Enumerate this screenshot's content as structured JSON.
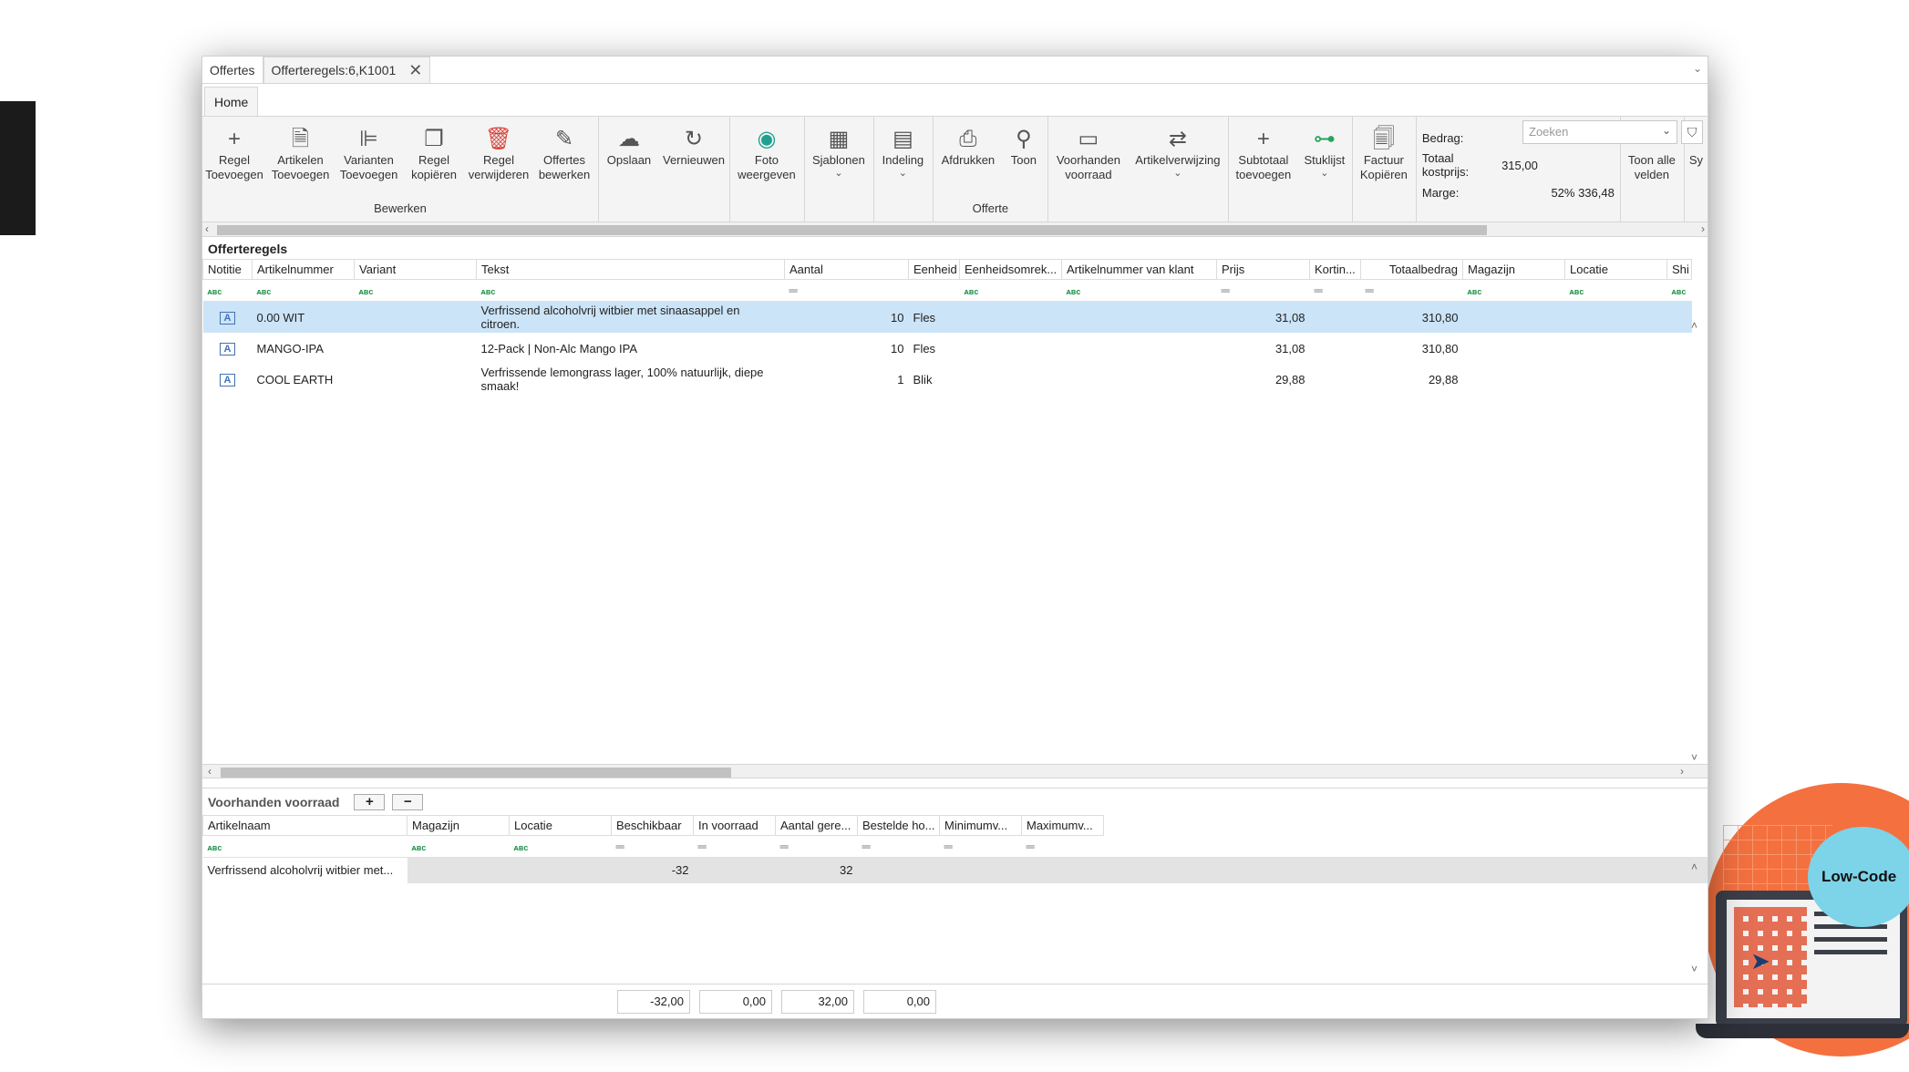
{
  "tabs": [
    {
      "label": "Offertes"
    },
    {
      "label": "Offerteregels:6,K1001"
    }
  ],
  "ribbon_tab": "Home",
  "ribbon": {
    "bewerken": {
      "label": "Bewerken",
      "buttons": [
        {
          "l1": "Regel",
          "l2": "Toevoegen",
          "icon": "plus-icon"
        },
        {
          "l1": "Artikelen",
          "l2": "Toevoegen",
          "icon": "document-add-icon"
        },
        {
          "l1": "Varianten",
          "l2": "Toevoegen",
          "icon": "tree-icon"
        },
        {
          "l1": "Regel",
          "l2": "kopiëren",
          "icon": "copy-icon"
        },
        {
          "l1": "Regel",
          "l2": "verwijderen",
          "icon": "trash-icon"
        },
        {
          "l1": "Offertes",
          "l2": "bewerken",
          "icon": "pencil-icon"
        }
      ]
    },
    "opslaan": "Opslaan",
    "vernieuwen": "Vernieuwen",
    "foto": {
      "l1": "Foto",
      "l2": "weergeven"
    },
    "sjablonen": "Sjablonen",
    "indeling": "Indeling",
    "offerte": {
      "label": "Offerte",
      "afdrukken": "Afdrukken",
      "toon": "Toon"
    },
    "voorhanden": {
      "l1": "Voorhanden",
      "l2": "voorraad"
    },
    "artikelverwijzing": "Artikelverwijzing",
    "subtotaal": {
      "l1": "Subtotaal",
      "l2": "toevoegen"
    },
    "stuklijst": "Stuklijst",
    "factuur": {
      "l1": "Factuur",
      "l2": "Kopiëren"
    },
    "summary": {
      "bedrag_label": "Bedrag:",
      "kostprijs_label": "Totaal kostprijs:",
      "kostprijs_value": "315,00",
      "marge_label": "Marge:",
      "marge_value": "52% 336,48"
    },
    "search_placeholder": "Zoeken",
    "toon_alle": {
      "l1": "Toon alle",
      "l2": "velden"
    },
    "cut_label": "Sy"
  },
  "offerteregels": {
    "title": "Offerteregels",
    "columns": [
      "Notitie",
      "Artikelnummer",
      "Variant",
      "Tekst",
      "Aantal",
      "Eenheid",
      "Eenheidsomrek...",
      "Artikelnummer van klant",
      "Prijs",
      "Kortin...",
      "Totaalbedrag",
      "Magazijn",
      "Locatie",
      "Shi"
    ],
    "rows": [
      {
        "artikelnummer": "0.00 WIT",
        "tekst": "Verfrissend alcoholvrij witbier met sinaasappel en citroen.",
        "aantal": "10",
        "eenheid": "Fles",
        "prijs": "31,08",
        "totaal": "310,80"
      },
      {
        "artikelnummer": "MANGO-IPA",
        "tekst": "12-Pack | Non-Alc Mango IPA",
        "aantal": "10",
        "eenheid": "Fles",
        "prijs": "31,08",
        "totaal": "310,80"
      },
      {
        "artikelnummer": "COOL EARTH",
        "tekst": "Verfrissende lemongrass lager, 100% natuurlijk, diepe smaak!",
        "aantal": "1",
        "eenheid": "Blik",
        "prijs": "29,88",
        "totaal": "29,88"
      }
    ]
  },
  "voorraad": {
    "title": "Voorhanden voorraad",
    "plus": "+",
    "minus": "−",
    "columns": [
      "Artikelnaam",
      "Magazijn",
      "Locatie",
      "Beschikbaar",
      "In voorraad",
      "Aantal gere...",
      "Bestelde ho...",
      "Minimumv...",
      "Maximumv..."
    ],
    "row": {
      "artikelnaam": "Verfrissend alcoholvrij witbier met...",
      "beschikbaar": "-32",
      "aantal_gereserveerd": "32"
    },
    "totals": [
      "-32,00",
      "0,00",
      "32,00",
      "0,00"
    ]
  },
  "badge": "Low-Code"
}
